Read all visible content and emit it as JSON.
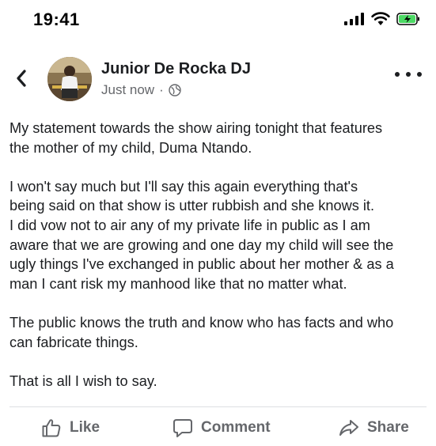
{
  "status_bar": {
    "time": "19:41"
  },
  "post": {
    "author": "Junior De Rocka DJ",
    "timestamp": "Just now",
    "separator": "·",
    "paragraphs": [
      "My statement towards the show airing tonight that features\nthe mother of my child, Duma Ntando.",
      "I won't say much but I'll say this again everything that's\nbeing said on that show is utter rubbish and she knows it.\nI did vow not to air any of my private life in public as I am\naware that we are growing and one day my child will see the\nugly things I've exchanged in public about her mother & as a\nman I cant risk my manhood like that no matter what.",
      "The public knows the truth and know who has facts and who\ncan fabricate things.",
      "That is all I wish to say."
    ]
  },
  "actions": {
    "like": "Like",
    "comment": "Comment",
    "share": "Share"
  },
  "icons": {
    "back": "chevron-left-icon",
    "globe": "globe-icon",
    "more": "more-horizontal-icon",
    "like": "thumbs-up-icon",
    "comment": "comment-bubble-icon",
    "share": "share-arrow-icon"
  },
  "colors": {
    "text": "#1c1e21",
    "secondary": "#65676b",
    "battery_fill": "#4cd964"
  }
}
